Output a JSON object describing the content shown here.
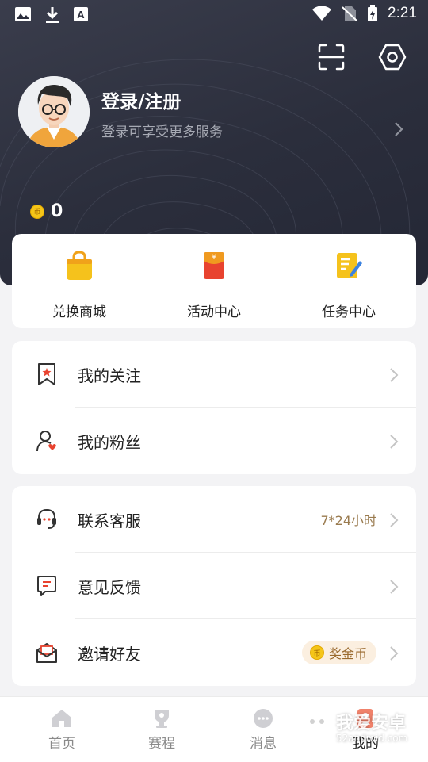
{
  "status_bar": {
    "time": "2:21"
  },
  "profile": {
    "title": "登录/注册",
    "subtitle": "登录可享受更多服务",
    "coins": "0",
    "coin_glyph": "币"
  },
  "quick_actions": [
    {
      "label": "兑换商城",
      "icon": "shopping-bag-icon"
    },
    {
      "label": "活动中心",
      "icon": "red-envelope-icon"
    },
    {
      "label": "任务中心",
      "icon": "task-note-icon"
    }
  ],
  "social": [
    {
      "label": "我的关注",
      "icon": "bookmark-star-icon"
    },
    {
      "label": "我的粉丝",
      "icon": "user-heart-icon"
    }
  ],
  "services": [
    {
      "label": "联系客服",
      "icon": "headset-icon",
      "extra": "7*24小时"
    },
    {
      "label": "意见反馈",
      "icon": "feedback-chat-icon"
    },
    {
      "label": "邀请好友",
      "icon": "mail-invite-icon",
      "badge": "奖金币"
    }
  ],
  "tabs": [
    {
      "label": "首页",
      "icon": "home-icon"
    },
    {
      "label": "赛程",
      "icon": "trophy-icon"
    },
    {
      "label": "消息",
      "icon": "message-icon"
    },
    {
      "label": "我的",
      "icon": "profile-icon",
      "active": true
    }
  ],
  "watermark": {
    "title": "我爱安卓",
    "url": "52android.com"
  },
  "colors": {
    "accent": "#f0a21a",
    "brand_red": "#e8432f",
    "hero_bg": "#2b2e3c",
    "chevron": "#c4c4c4"
  }
}
